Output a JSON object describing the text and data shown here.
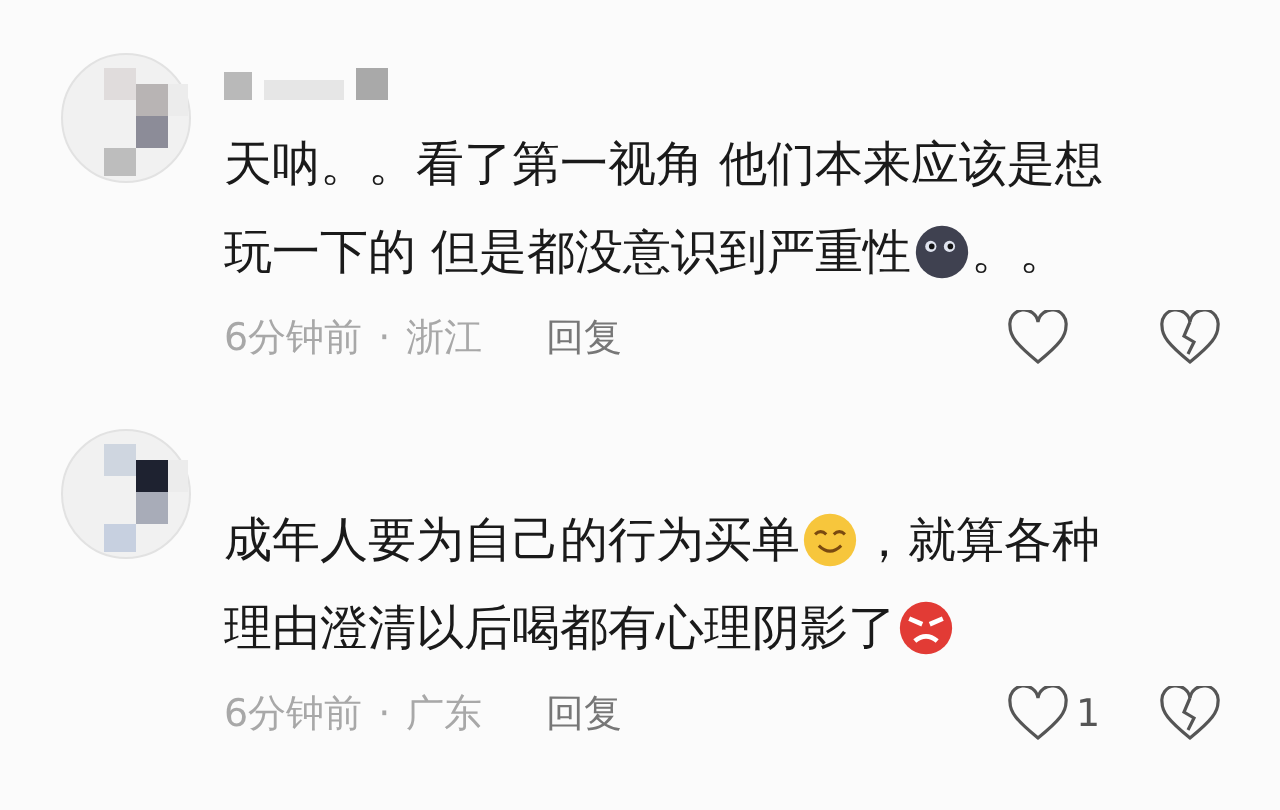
{
  "comments": [
    {
      "redacted_name": true,
      "lines": [
        [
          {
            "kind": "text",
            "text": "天呐。。看了第一视角 他们本来应该是想"
          }
        ],
        [
          {
            "kind": "text",
            "text": "玩一下的 但是都没意识到严重性"
          },
          {
            "kind": "emoji-dark"
          },
          {
            "kind": "text",
            "text": "。。"
          }
        ]
      ],
      "time": "6分钟前",
      "separator": "·",
      "location": "浙江",
      "reply": "回复"
    },
    {
      "redacted_name": false,
      "lines": [
        [
          {
            "kind": "text",
            "text": "成年人要为自己的行为买单"
          },
          {
            "kind": "emoji-smile"
          },
          {
            "kind": "text",
            "text": "，就算各种"
          }
        ],
        [
          {
            "kind": "text",
            "text": "理由澄清以后喝都有心理阴影了"
          },
          {
            "kind": "emoji-angry"
          }
        ]
      ],
      "time": "6分钟前",
      "separator": "·",
      "location": "广东",
      "reply": "回复",
      "like_count": "1"
    }
  ]
}
